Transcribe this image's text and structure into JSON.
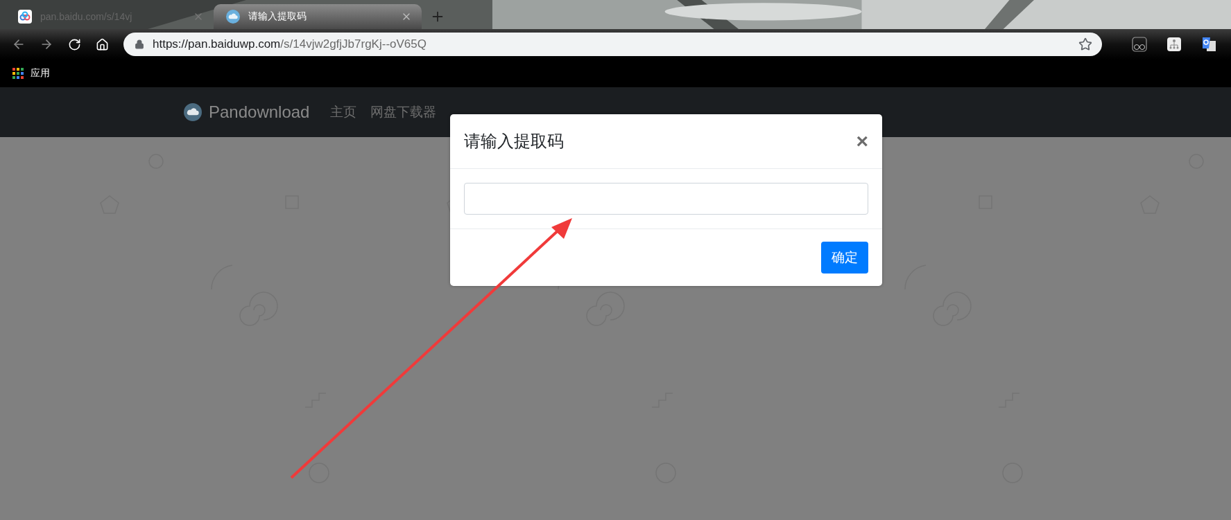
{
  "browser": {
    "tabs": [
      {
        "title": "pan.baidu.com/s/14vj",
        "selected": false
      },
      {
        "title": "请输入提取码",
        "selected": true
      }
    ],
    "url": {
      "host": "https://pan.baiduwp.com",
      "path": "/s/14vjw2gfjJb7rgKj--oV65Q"
    },
    "bookmarks": [
      {
        "label": "应用"
      }
    ]
  },
  "site": {
    "brand": "Pandownload",
    "nav": [
      {
        "label": "主页"
      },
      {
        "label": "网盘下载器"
      }
    ]
  },
  "modal": {
    "title": "请输入提取码",
    "close": "×",
    "button": "确定"
  }
}
